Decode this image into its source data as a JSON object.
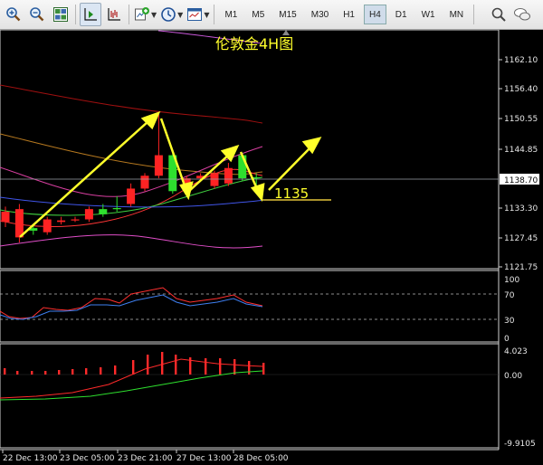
{
  "toolbar": {
    "timeframes": [
      "M1",
      "M5",
      "M15",
      "M30",
      "H1",
      "H4",
      "D1",
      "W1",
      "MN"
    ],
    "active_timeframe": "H4"
  },
  "chart": {
    "title": "伦敦金4H图",
    "annotation": "1135",
    "current_price_label": "1138.70",
    "price_axis": [
      "1162.10",
      "1156.40",
      "1150.55",
      "1144.85",
      "1139.00",
      "1133.30",
      "1127.45",
      "1121.75"
    ],
    "rsi_axis": [
      "100",
      "70",
      "30",
      "0"
    ],
    "macd_axis": [
      "4.023",
      "0.00",
      "-9.9105"
    ],
    "time_axis": [
      "22 Dec 13:00",
      "23 Dec 05:00",
      "23 Dec 21:00",
      "27 Dec 13:00",
      "28 Dec 05:00"
    ]
  },
  "chart_data": {
    "type": "candlestick",
    "title": "伦敦金4H图",
    "ylim": [
      1121.75,
      1165
    ],
    "candles": [
      {
        "o": 1132.5,
        "c": 1130.5,
        "h": 1133.5,
        "l": 1129.5,
        "color": "red"
      },
      {
        "o": 1133,
        "c": 1127.5,
        "h": 1134,
        "l": 1126.5,
        "color": "red"
      },
      {
        "o": 1128.8,
        "c": 1129.3,
        "h": 1130,
        "l": 1128,
        "color": "green"
      },
      {
        "o": 1128.5,
        "c": 1131,
        "h": 1131.5,
        "l": 1128,
        "color": "red"
      },
      {
        "o": 1130.5,
        "c": 1130.8,
        "h": 1131.5,
        "l": 1130,
        "color": "red"
      },
      {
        "o": 1130.8,
        "c": 1131,
        "h": 1131.5,
        "l": 1130.5,
        "color": "red"
      },
      {
        "o": 1131,
        "c": 1133,
        "h": 1133.5,
        "l": 1130.5,
        "color": "red"
      },
      {
        "o": 1132,
        "c": 1133,
        "h": 1134,
        "l": 1131.5,
        "color": "green"
      },
      {
        "o": 1133,
        "c": 1133.2,
        "h": 1135.5,
        "l": 1132.5,
        "color": "green"
      },
      {
        "o": 1134,
        "c": 1137,
        "h": 1138,
        "l": 1133.5,
        "color": "red"
      },
      {
        "o": 1137,
        "c": 1139.5,
        "h": 1140,
        "l": 1136.5,
        "color": "red"
      },
      {
        "o": 1139.5,
        "c": 1143.5,
        "h": 1151.5,
        "l": 1139,
        "color": "red"
      },
      {
        "o": 1143.5,
        "c": 1136.5,
        "h": 1143.8,
        "l": 1136,
        "color": "green"
      },
      {
        "o": 1138,
        "c": 1139,
        "h": 1139.5,
        "l": 1137.5,
        "color": "red"
      },
      {
        "o": 1139,
        "c": 1139.5,
        "h": 1140,
        "l": 1138.5,
        "color": "red"
      },
      {
        "o": 1137.5,
        "c": 1140,
        "h": 1140.5,
        "l": 1137,
        "color": "red"
      },
      {
        "o": 1138,
        "c": 1141,
        "h": 1142,
        "l": 1137.5,
        "color": "red"
      },
      {
        "o": 1143.5,
        "c": 1139,
        "h": 1144,
        "l": 1138.5,
        "color": "green"
      },
      {
        "o": 1139,
        "c": 1139.2,
        "h": 1140,
        "l": 1137,
        "color": "green"
      }
    ]
  }
}
